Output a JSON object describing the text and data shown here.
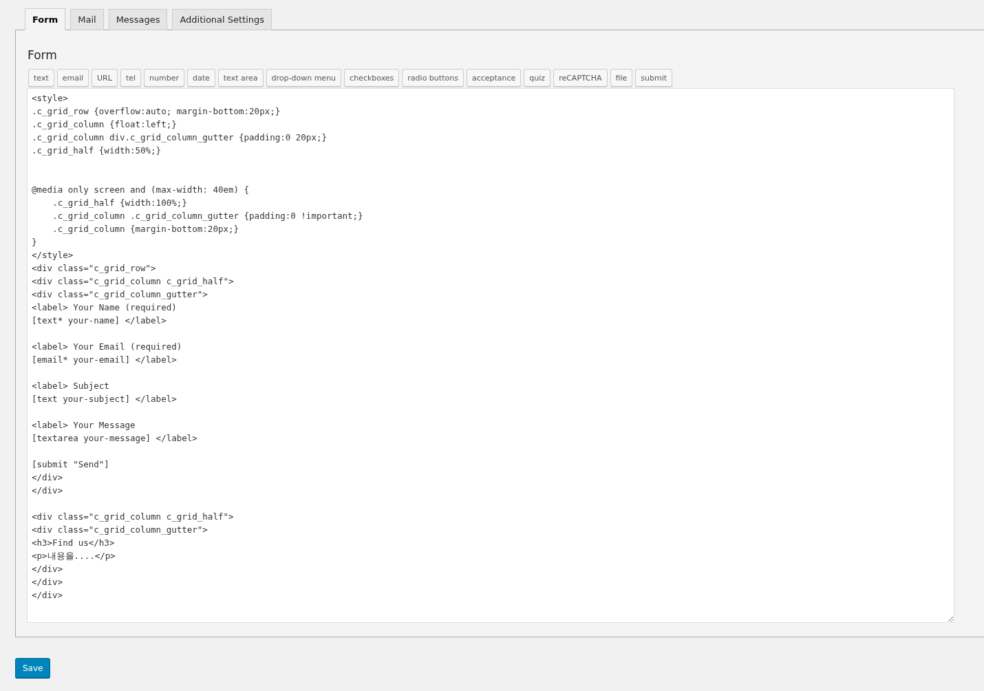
{
  "tabs": [
    {
      "label": "Form",
      "selected": true
    },
    {
      "label": "Mail",
      "selected": false
    },
    {
      "label": "Messages",
      "selected": false
    },
    {
      "label": "Additional Settings",
      "selected": false
    }
  ],
  "panel": {
    "title": "Form",
    "tag_buttons": [
      "text",
      "email",
      "URL",
      "tel",
      "number",
      "date",
      "text area",
      "drop-down menu",
      "checkboxes",
      "radio buttons",
      "acceptance",
      "quiz",
      "reCAPTCHA",
      "file",
      "submit"
    ],
    "editor": {
      "value": "<style>\n.c_grid_row {overflow:auto; margin-bottom:20px;}\n.c_grid_column {float:left;}\n.c_grid_column div.c_grid_column_gutter {padding:0 20px;}\n.c_grid_half {width:50%;}\n\n\n@media only screen and (max-width: 40em) {\n    .c_grid_half {width:100%;}\n    .c_grid_column .c_grid_column_gutter {padding:0 !important;}\n    .c_grid_column {margin-bottom:20px;}\n}\n</style>\n<div class=\"c_grid_row\">\n<div class=\"c_grid_column c_grid_half\">\n<div class=\"c_grid_column_gutter\">\n<label> Your Name (required)\n[text* your-name] </label>\n\n<label> Your Email (required)\n[email* your-email] </label>\n\n<label> Subject\n[text your-subject] </label>\n\n<label> Your Message\n[textarea your-message] </label>\n\n[submit \"Send\"]\n</div>\n</div>\n\n<div class=\"c_grid_column c_grid_half\">\n<div class=\"c_grid_column_gutter\">\n<h3>Find us</h3>\n<p>내용을....</p>\n</div>\n</div>\n</div>"
    }
  },
  "save_button": "Save"
}
